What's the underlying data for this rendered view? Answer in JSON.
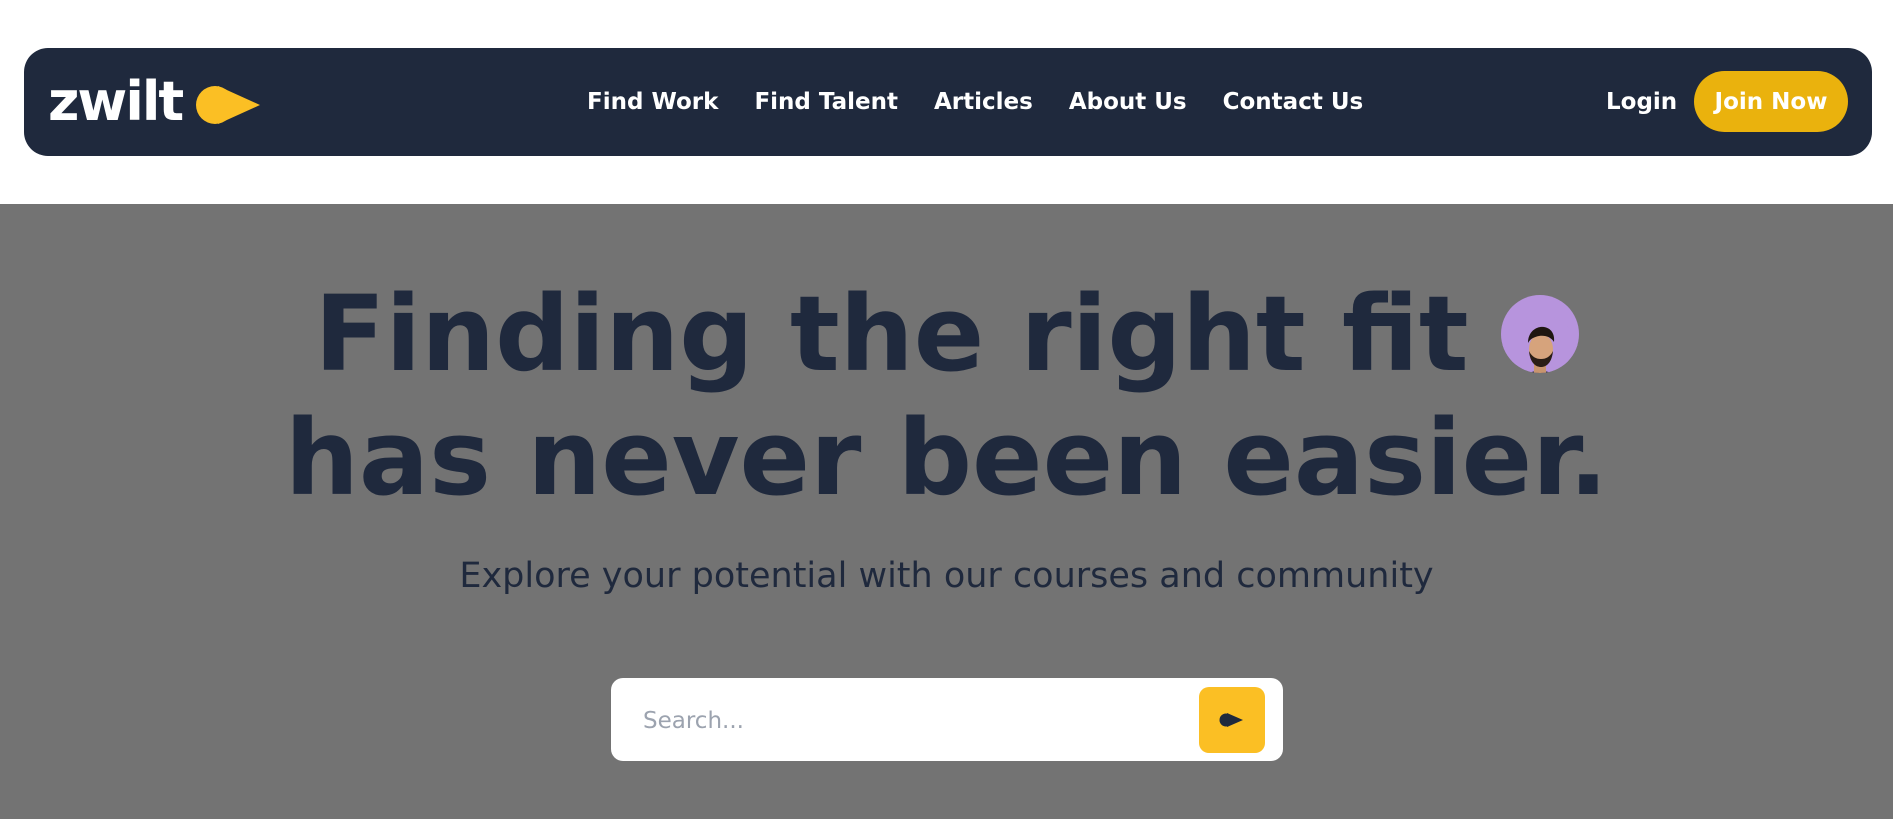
{
  "brand": {
    "name": "zwilt",
    "logo_icon": "arrow-forward-icon",
    "accent_color": "#eab20d"
  },
  "nav": {
    "links": [
      {
        "label": "Find Work"
      },
      {
        "label": "Find Talent"
      },
      {
        "label": "Articles"
      },
      {
        "label": "About Us"
      },
      {
        "label": "Contact Us"
      }
    ],
    "login_label": "Login",
    "join_label": "Join Now"
  },
  "hero": {
    "headline_line1": "Finding the right fit",
    "headline_line2": "has never been easier.",
    "subtitle": "Explore your potential with our courses and community",
    "avatar_icon": "person-avatar"
  },
  "search": {
    "placeholder": "Search...",
    "value": "",
    "button_icon": "arrow-forward-icon"
  },
  "colors": {
    "navbar_bg": "#1f293d",
    "hero_bg": "#737373",
    "text_dark": "#1f293d",
    "search_button": "#fbbf24"
  }
}
